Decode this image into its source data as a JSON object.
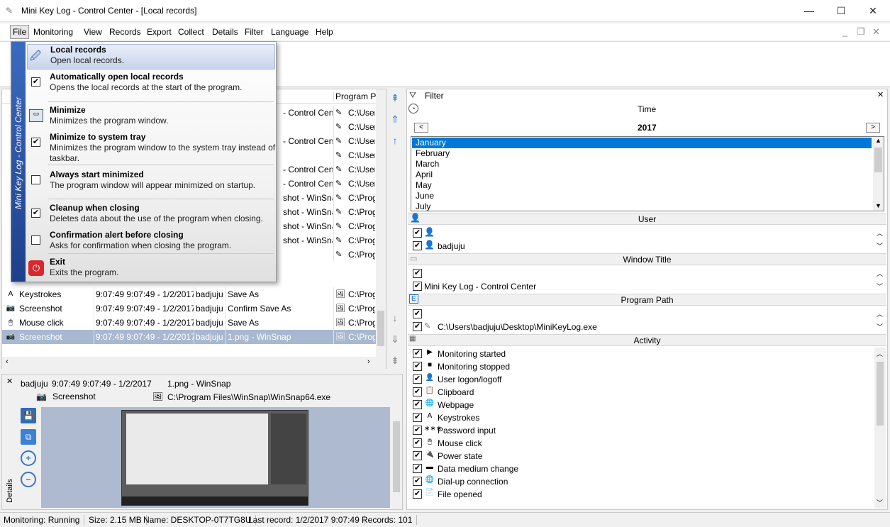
{
  "window": {
    "title": "Mini Key Log - Control Center - [Local records]",
    "min": "—",
    "max": "☐",
    "close": "✕"
  },
  "menu": [
    "File",
    "Monitoring",
    "View",
    "Records",
    "Export",
    "Collect",
    "Details",
    "Filter",
    "Language",
    "Help"
  ],
  "dropdown": {
    "side_text": "Mini Key Log - Control Center",
    "items": [
      {
        "title": "Local records",
        "desc": "Open local records.",
        "check": null
      },
      {
        "title": "Automatically open local records",
        "desc": "Opens the local records at the start of the program.",
        "check": true
      },
      {
        "title": "Minimize",
        "desc": "Minimizes the program window.",
        "check": null
      },
      {
        "title": "Minimize to system tray",
        "desc": "Minimizes the program window to the system tray instead of taskbar.",
        "check": true
      },
      {
        "title": "Always start minimized",
        "desc": "The program window will appear minimized on startup.",
        "check": false
      },
      {
        "title": "Cleanup when closing",
        "desc": "Deletes data about the use of the program when closing.",
        "check": true
      },
      {
        "title": "Confirmation alert before closing",
        "desc": "Asks for confirmation when closing the program.",
        "check": false
      },
      {
        "title": "Exit",
        "desc": "Exits the program.",
        "check": null
      }
    ]
  },
  "records": {
    "header_program": "Program P",
    "visible_partial": [
      {
        "title": "- Control Cent",
        "path": "C:\\User"
      },
      {
        "title": "",
        "path": "C:\\User"
      },
      {
        "title": "- Control Cent",
        "path": "C:\\User"
      },
      {
        "title": "",
        "path": "C:\\User"
      },
      {
        "title": "- Control Cent",
        "path": "C:\\User"
      },
      {
        "title": "- Control Cent",
        "path": "C:\\User"
      },
      {
        "title": "shot - WinSnap",
        "path": "C:\\Prog"
      },
      {
        "title": "shot - WinSnap",
        "path": "C:\\Prog"
      },
      {
        "title": "shot - WinSnap",
        "path": "C:\\Prog"
      },
      {
        "title": "shot - WinSnap",
        "path": "C:\\Prog"
      },
      {
        "title": "",
        "path": "C:\\Prog"
      }
    ],
    "rows": [
      {
        "activity": "Keystrokes",
        "time": "9:07:49 9:07:49  - 1/2/2017",
        "user": "badjuju",
        "title": "Save As",
        "path": "C:\\Prog",
        "selected": false
      },
      {
        "activity": "Screenshot",
        "time": "9:07:49 9:07:49  - 1/2/2017",
        "user": "badjuju",
        "title": "Confirm Save As",
        "path": "C:\\Prog",
        "selected": false
      },
      {
        "activity": "Mouse click",
        "time": "9:07:49 9:07:49  - 1/2/2017",
        "user": "badjuju",
        "title": "Save As",
        "path": "C:\\Prog",
        "selected": false
      },
      {
        "activity": "Screenshot",
        "time": "9:07:49 9:07:49  - 1/2/2017",
        "user": "badjuju",
        "title": "1.png - WinSnap",
        "path": "C:\\Prog",
        "selected": true
      }
    ]
  },
  "details": {
    "user": "badjuju",
    "time": "9:07:49 9:07:49  - 1/2/2017",
    "title": "1.png - WinSnap",
    "activity": "Screenshot",
    "path": "C:\\Program Files\\WinSnap\\WinSnap64.exe",
    "side_label": "Details"
  },
  "filter": {
    "header": "Filter",
    "time_label": "Time",
    "year": "2017",
    "prev": "<",
    "next": ">",
    "months": [
      "January",
      "February",
      "March",
      "April",
      "May",
      "June",
      "July"
    ],
    "user_label": "User",
    "users": [
      "",
      "badjuju"
    ],
    "window_title_label": "Window Title",
    "window_titles": [
      "",
      "Mini Key Log - Control Center"
    ],
    "program_path_label": "Program Path",
    "program_paths": [
      "",
      "C:\\Users\\badjuju\\Desktop\\MiniKeyLog.exe"
    ],
    "activity_label": "Activity",
    "activities": [
      "Monitoring started",
      "Monitoring stopped",
      "User logon/logoff",
      "Clipboard",
      "Webpage",
      "Keystrokes",
      "Password input",
      "Mouse click",
      "Power state",
      "Data medium change",
      "Dial-up connection",
      "File opened"
    ]
  },
  "status": {
    "monitoring": "Monitoring: Running",
    "size": "Size: 2.15 MB",
    "name": "Name: DESKTOP-0T7TG8U",
    "last": "Last record: 1/2/2017 9:07:49",
    "records": "Records: 101"
  }
}
